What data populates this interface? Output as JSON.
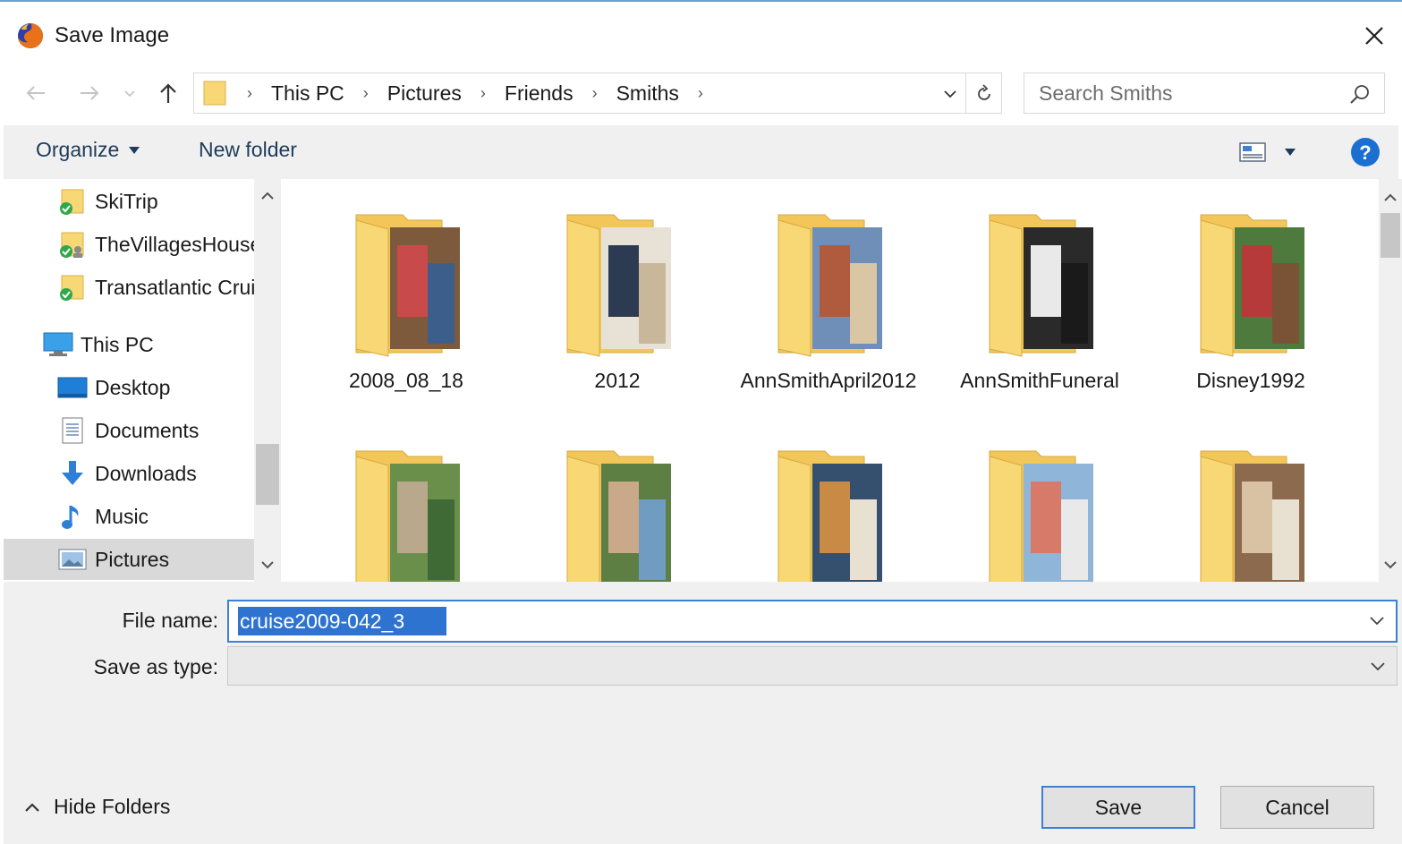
{
  "window": {
    "title": "Save Image",
    "icon": "firefox-icon"
  },
  "navigation": {
    "back_icon": "arrow-left-icon",
    "forward_icon": "arrow-right-icon",
    "recent_icon": "chevron-down-icon",
    "up_icon": "arrow-up-icon"
  },
  "address": {
    "crumbs": [
      "This PC",
      "Pictures",
      "Friends",
      "Smiths"
    ]
  },
  "search": {
    "placeholder": "Search Smiths"
  },
  "toolbar": {
    "organize_label": "Organize",
    "new_folder_label": "New folder"
  },
  "sidebar": {
    "items": [
      {
        "label": "SkiTrip",
        "icon": "folder-synced-icon"
      },
      {
        "label": "TheVillagesHouse",
        "icon": "folder-shared-icon"
      },
      {
        "label": "Transatlantic Cruise",
        "icon": "folder-synced-icon"
      },
      {
        "label": "This PC",
        "icon": "computer-icon"
      },
      {
        "label": "Desktop",
        "icon": "desktop-icon"
      },
      {
        "label": "Documents",
        "icon": "documents-icon"
      },
      {
        "label": "Downloads",
        "icon": "downloads-icon"
      },
      {
        "label": "Music",
        "icon": "music-icon"
      },
      {
        "label": "Pictures",
        "icon": "pictures-icon",
        "selected": true
      }
    ]
  },
  "folders": [
    {
      "name": "2008_08_18"
    },
    {
      "name": "2012"
    },
    {
      "name": "AnnSmithApril2012"
    },
    {
      "name": "AnnSmithFuneral"
    },
    {
      "name": "Disney1992"
    },
    {
      "name": ""
    },
    {
      "name": ""
    },
    {
      "name": ""
    },
    {
      "name": ""
    },
    {
      "name": ""
    }
  ],
  "form": {
    "file_name_label": "File name:",
    "file_name_value": "cruise2009-042_3",
    "save_as_type_label": "Save as type:",
    "save_as_type_value": ""
  },
  "footer": {
    "hide_folders_label": "Hide Folders",
    "save_label": "Save",
    "cancel_label": "Cancel"
  },
  "colors": {
    "accent": "#3c7fd4",
    "selection": "#2f73d1",
    "folder": "#f8d775",
    "help": "#1a6fd1"
  }
}
